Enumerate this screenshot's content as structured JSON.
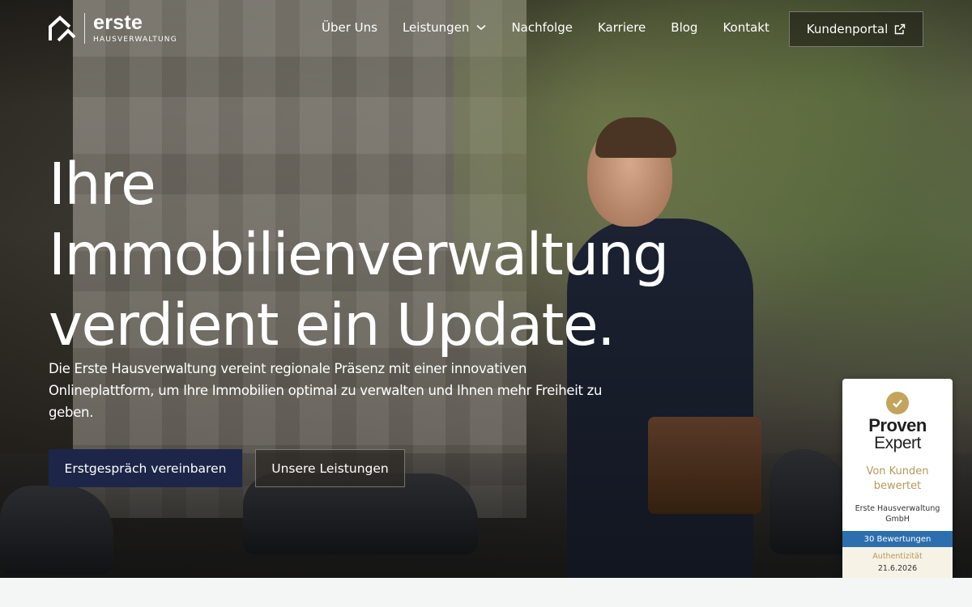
{
  "brand": {
    "name": "erste",
    "subtitle": "HAUSVERWALTUNG"
  },
  "nav": {
    "items": [
      {
        "label": "Über Uns"
      },
      {
        "label": "Leistungen",
        "has_dropdown": true
      },
      {
        "label": "Nachfolge"
      },
      {
        "label": "Karriere"
      },
      {
        "label": "Blog"
      },
      {
        "label": "Kontakt"
      }
    ],
    "portal_label": "Kundenportal",
    "portal_icon": "external-link-icon"
  },
  "hero": {
    "headline_lines": [
      "Ihre",
      "Immobilienverwaltung",
      "verdient ein Update."
    ],
    "subtext": "Die Erste Hausverwaltung vereint regionale Präsenz mit einer innovativen Onlineplattform, um Ihre Immobilien optimal zu verwalten und Ihnen mehr Freiheit zu geben.",
    "primary_cta": "Erstgespräch vereinbaren",
    "secondary_cta": "Unsere Leistungen"
  },
  "proven_expert": {
    "title_line1": "Proven",
    "title_line2": "Expert",
    "tagline": "Von Kunden bewertet",
    "company": "Erste Hausverwaltung GmbH",
    "reviews": "30 Bewertungen",
    "auth_label": "Authentizität",
    "auth_date": "21.6.2026",
    "accent_color": "#c3a45c",
    "reviews_color": "#2d6fae"
  },
  "colors": {
    "primary_button": "#1d2648",
    "text_on_dark": "#ffffff"
  }
}
